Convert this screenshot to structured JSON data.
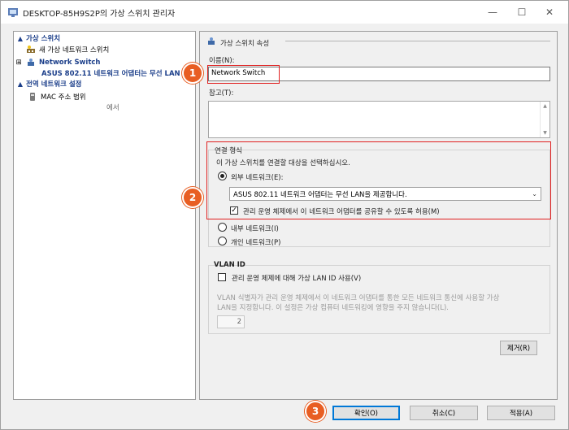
{
  "window": {
    "title": "DESKTOP-85H9S2P의 가상 스위치 관리자"
  },
  "left_pane": {
    "section_virtual_switches": "가상 스위치",
    "new_switch": "새 가상 네트워크 스위치",
    "switch_name": "Network Switch",
    "switch_adapter": "ASUS 802.11 네트워크 어댑터는 무선 LAN",
    "section_global": "전역 네트워크 설정",
    "mac_range": "MAC 주소 범위",
    "mac_range_value": "에서"
  },
  "right_pane": {
    "header": "가상 스위치 속성",
    "name_label": "이름(N):",
    "name_value": "Network Switch",
    "notes_label": "참고(T):",
    "connection_type_label": "연결 형식",
    "connection_prompt": "이 가상 스위치를 연결할 대상을 선택하십시오.",
    "external_label": "외부 네트워크(E):",
    "external_adapter": "ASUS 802.11 네트워크 어댑터는 무선 LAN을 제공합니다.",
    "share_label": "관리 운영 체제에서 이 네트워크 어댑터를 공유할 수 있도록 허용(M)",
    "internal_label": "내부 네트워크(I)",
    "private_label": "개인 네트워크(P)",
    "vlan_title": "VLAN ID",
    "vlan_enable_label": "관리 운영 체제에 대해 가상 LAN ID 사용(V)",
    "vlan_desc_line1": "VLAN 식별자가 관리 운영 체제에서 이 네트워크 어댑터를 통한 모든 네트워크 통신에 사용할 가상",
    "vlan_desc_line2": "LAN을 지정합니다. 이 설정은 가상 컴퓨터 네트워킹에 영향을 주지 않습니다(L).",
    "vlan_value": "2",
    "remove_button": "제거(R)"
  },
  "footer": {
    "ok_button": "확인(O)",
    "cancel_button": "취소(C)",
    "apply_button": "적용(A)"
  },
  "callouts": {
    "one": "1",
    "two": "2",
    "three": "3"
  }
}
